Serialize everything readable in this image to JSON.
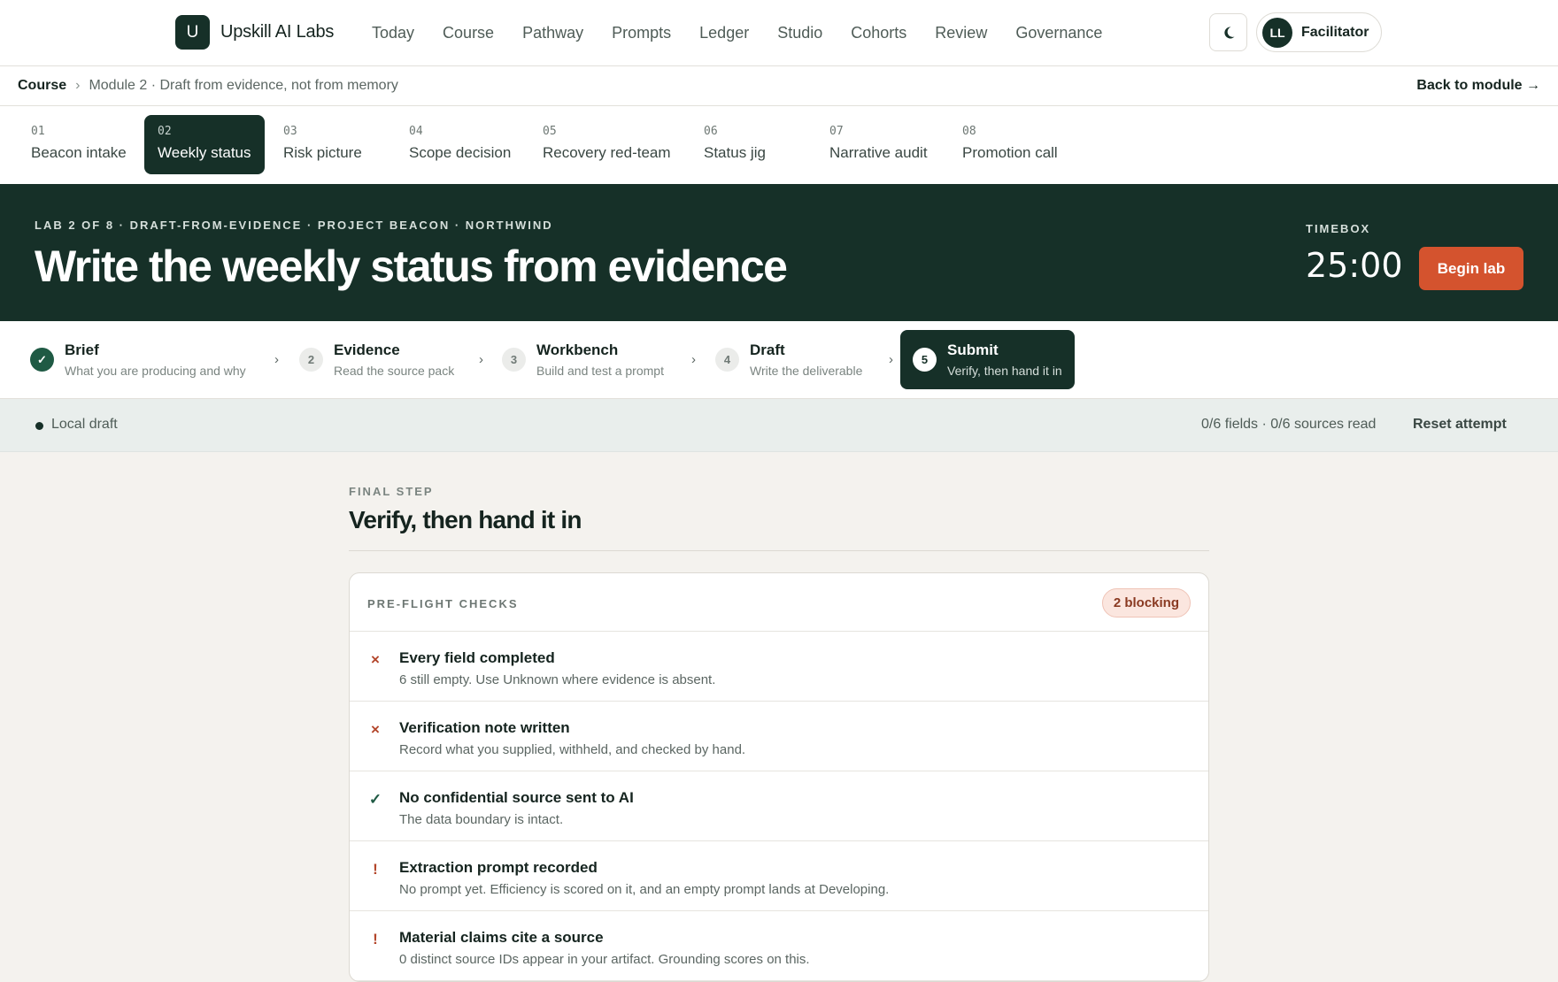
{
  "app": {
    "logo_letter": "U",
    "name": "Upskill AI Labs"
  },
  "nav": [
    "Today",
    "Course",
    "Pathway",
    "Prompts",
    "Ledger",
    "Studio",
    "Cohorts",
    "Review",
    "Governance"
  ],
  "user": {
    "initials": "LL",
    "role": "Facilitator"
  },
  "breadcrumb": {
    "root": "Course",
    "separator": "›",
    "current": "Module 2 · Draft from evidence, not from memory",
    "back": "Back to module →"
  },
  "labs": [
    {
      "num": "01",
      "label": "Beacon intake"
    },
    {
      "num": "02",
      "label": "Weekly status"
    },
    {
      "num": "03",
      "label": "Risk picture"
    },
    {
      "num": "04",
      "label": "Scope decision"
    },
    {
      "num": "05",
      "label": "Recovery red-team"
    },
    {
      "num": "06",
      "label": "Status jig"
    },
    {
      "num": "07",
      "label": "Narrative audit"
    },
    {
      "num": "08",
      "label": "Promotion call"
    }
  ],
  "hero": {
    "eyebrow": "LAB 2 OF 8 · DRAFT-FROM-EVIDENCE · PROJECT BEACON · NORTHWIND",
    "title": "Write the weekly status from evidence",
    "timebox_label": "TIMEBOX",
    "timebox_value": "25:00",
    "begin_label": "Begin lab"
  },
  "steps": [
    {
      "badge": "✓",
      "title": "Brief",
      "sub": "What you are producing and why"
    },
    {
      "badge": "2",
      "title": "Evidence",
      "sub": "Read the source pack"
    },
    {
      "badge": "3",
      "title": "Workbench",
      "sub": "Build and test a prompt"
    },
    {
      "badge": "4",
      "title": "Draft",
      "sub": "Write the deliverable"
    },
    {
      "badge": "5",
      "title": "Submit",
      "sub": "Verify, then hand it in"
    }
  ],
  "status": {
    "draft": "Local draft",
    "progress": "0/6 fields · 0/6 sources read",
    "reset": "Reset attempt"
  },
  "main": {
    "eyebrow": "FINAL STEP",
    "title": "Verify, then hand it in"
  },
  "checks_card": {
    "eyebrow": "PRE-FLIGHT CHECKS",
    "badge": "2 blocking",
    "items": [
      {
        "icon": "×",
        "title": "Every field completed",
        "desc": "6 still empty. Use Unknown where evidence is absent."
      },
      {
        "icon": "×",
        "title": "Verification note written",
        "desc": "Record what you supplied, withheld, and checked by hand."
      },
      {
        "icon": "✓",
        "title": "No confidential source sent to AI",
        "desc": "The data boundary is intact."
      },
      {
        "icon": "!",
        "title": "Extraction prompt recorded",
        "desc": "No prompt yet. Efficiency is scored on it, and an empty prompt lands at Developing."
      },
      {
        "icon": "!",
        "title": "Material claims cite a source",
        "desc": "0 distinct source IDs appear in your artifact. Grounding scores on this."
      }
    ]
  }
}
